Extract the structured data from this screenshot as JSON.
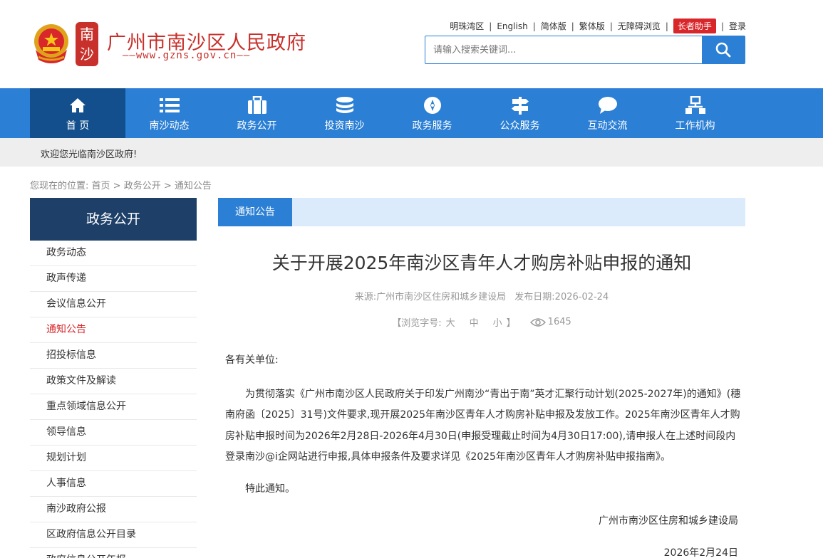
{
  "header": {
    "seal_text": "南沙",
    "site_title": "广州市南沙区人民政府",
    "site_url": "——www.gzns.gov.cn——",
    "top_links": [
      "明珠湾区",
      "English",
      "简体版",
      "繁体版",
      "无障碍浏览",
      "长者助手",
      "登录"
    ],
    "search_placeholder": "请输入搜索关键词..."
  },
  "nav": {
    "items": [
      {
        "label": "首 页",
        "icon": "home-icon"
      },
      {
        "label": "南沙动态",
        "icon": "list-icon"
      },
      {
        "label": "政务公开",
        "icon": "briefcase-icon"
      },
      {
        "label": "投资南沙",
        "icon": "coins-icon"
      },
      {
        "label": "政务服务",
        "icon": "compass-icon"
      },
      {
        "label": "公众服务",
        "icon": "signpost-icon"
      },
      {
        "label": "互动交流",
        "icon": "chat-icon"
      },
      {
        "label": "工作机构",
        "icon": "org-chart-icon"
      }
    ]
  },
  "welcome": "欢迎您光临南沙区政府!",
  "breadcrumb": {
    "prefix": "您现在的位置:",
    "items": [
      "首页",
      "政务公开",
      "通知公告"
    ],
    "separator": " > "
  },
  "sidebar": {
    "title": "政务公开",
    "items": [
      {
        "label": "政务动态"
      },
      {
        "label": "政声传递"
      },
      {
        "label": "会议信息公开"
      },
      {
        "label": "通知公告",
        "active": true
      },
      {
        "label": "招投标信息"
      },
      {
        "label": "政策文件及解读"
      },
      {
        "label": "重点领域信息公开"
      },
      {
        "label": "领导信息"
      },
      {
        "label": "规划计划"
      },
      {
        "label": "人事信息"
      },
      {
        "label": "南沙政府公报"
      },
      {
        "label": "区政府信息公开目录"
      },
      {
        "label": "政府信息公开年报"
      }
    ]
  },
  "article": {
    "tab": "通知公告",
    "title": "关于开展2025年南沙区青年人才购房补贴申报的通知",
    "source": "来源:广州市南沙区住房和城乡建设局",
    "date": "发布日期:2026-02-24",
    "font_label": "【浏览字号:",
    "font_big": "大",
    "font_mid": "中",
    "font_small": "小",
    "font_end": "】",
    "views": "1645",
    "greeting": "各有关单位:",
    "para": "为贯彻落实《广州市南沙区人民政府关于印发广州南沙“青出于南”英才汇聚行动计划(2025-2027年)的通知》(穗南府函〔2025〕31号)文件要求,现开展2025年南沙区青年人才购房补贴申报及发放工作。2025年南沙区青年人才购房补贴申报时间为2026年2月28日-2026年4月30日(申报受理截止时间为4月30日17:00),请申报人在上述时间段内登录南沙@i企网站进行申报,具体申报条件及要求详见《2025年南沙区青年人才购房补贴申报指南》。",
    "closing": "特此通知。",
    "signature": "广州市南沙区住房和城乡建设局",
    "sign_date": "2026年2月24日"
  },
  "colors": {
    "brand_red": "#c8302b",
    "nav_blue": "#2b7fd4",
    "nav_active": "#124f8c",
    "side_head": "#1d3f68",
    "active_link": "#d8262b"
  }
}
